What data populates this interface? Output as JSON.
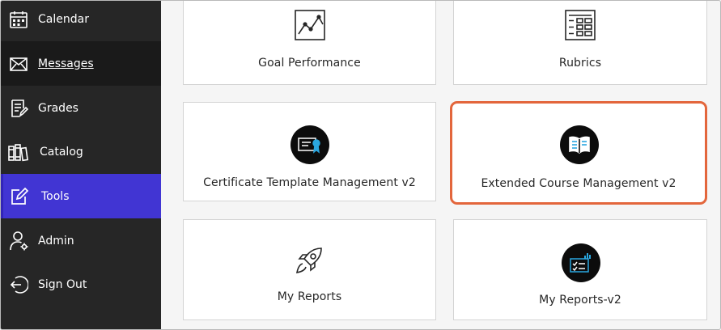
{
  "sidebar": {
    "items": [
      {
        "label": "Calendar",
        "icon": "calendar-icon"
      },
      {
        "label": "Messages",
        "icon": "envelope-icon"
      },
      {
        "label": "Grades",
        "icon": "gradebook-icon"
      },
      {
        "label": "Catalog",
        "icon": "catalog-books-icon"
      },
      {
        "label": "Tools",
        "icon": "tools-edit-icon"
      },
      {
        "label": "Admin",
        "icon": "admin-user-icon"
      },
      {
        "label": "Sign Out",
        "icon": "sign-out-icon"
      }
    ]
  },
  "tools": {
    "cards": [
      {
        "label": "Goal Performance",
        "icon": "line-chart-icon"
      },
      {
        "label": "Rubrics",
        "icon": "rubric-grid-icon"
      },
      {
        "label": "Certificate Template Management v2",
        "icon": "certificate-icon"
      },
      {
        "label": "Extended Course Management v2",
        "icon": "open-book-icon"
      },
      {
        "label": "My Reports",
        "icon": "rocket-icon"
      },
      {
        "label": "My Reports-v2",
        "icon": "report-checklist-icon"
      }
    ]
  },
  "colors": {
    "sidebar_bg": "#262626",
    "active_nav": "#4135d3",
    "highlight_border": "#e3663c",
    "badge_bg": "#0c0c0c",
    "badge_accent": "#2aa7e0"
  }
}
